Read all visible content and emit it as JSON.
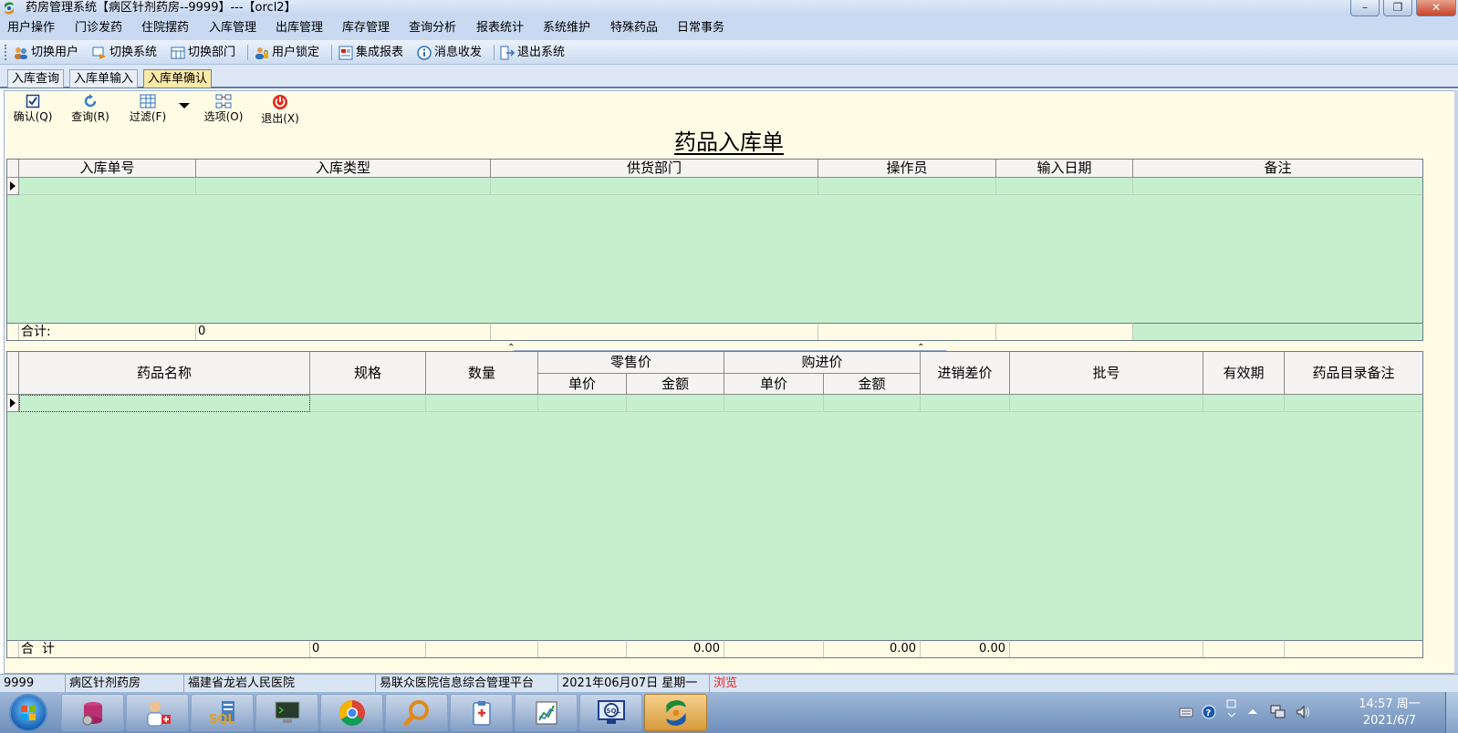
{
  "window": {
    "title": "药房管理系统【病区针剂药房--9999】---【orcl2】",
    "min_glyph": "–",
    "max_glyph": "❐",
    "close_glyph": "✕"
  },
  "menu": [
    "用户操作",
    "门诊发药",
    "住院摆药",
    "入库管理",
    "出库管理",
    "库存管理",
    "查询分析",
    "报表统计",
    "系统维护",
    "特殊药品",
    "日常事务"
  ],
  "toolbar": [
    {
      "label": "切换用户",
      "icon": "users-icon"
    },
    {
      "label": "切换系统",
      "icon": "switch-system-icon"
    },
    {
      "label": "切换部门",
      "icon": "department-icon"
    },
    {
      "label": "用户锁定",
      "icon": "user-lock-icon"
    },
    {
      "label": "集成报表",
      "icon": "report-icon"
    },
    {
      "label": "消息收发",
      "icon": "info-icon"
    },
    {
      "label": "退出系统",
      "icon": "exit-icon"
    }
  ],
  "tabs": [
    "入库查询",
    "入库单输入",
    "入库单确认"
  ],
  "actions": {
    "confirm": "确认(Q)",
    "query": "查询(R)",
    "filter": "过滤(F)",
    "options": "选项(O)",
    "exit": "退出(X)"
  },
  "doc_title": "药品入库单",
  "top_grid": {
    "columns": [
      "入库单号",
      "入库类型",
      "供货部门",
      "操作员",
      "输入日期",
      "备注"
    ],
    "footer_label": "合计:",
    "footer_value": "0"
  },
  "bottom_grid": {
    "columns": {
      "name": "药品名称",
      "spec": "规格",
      "qty": "数量",
      "retail": "零售价",
      "retail_unit": "单价",
      "retail_amount": "金额",
      "purchase": "购进价",
      "purchase_unit": "单价",
      "purchase_amount": "金额",
      "diff": "进销差价",
      "batch": "批号",
      "expiry": "有效期",
      "note": "药品目录备注"
    },
    "footer": {
      "label": "合  计",
      "qty": "0",
      "retail_amount": "0.00",
      "purchase_amount": "0.00",
      "diff": "0.00"
    }
  },
  "status": {
    "code": "9999",
    "dept": "病区针剂药房",
    "hospital": "福建省龙岩人民医院",
    "platform": "易联众医院信息综合管理平台",
    "date": "2021年06月07日  星期一",
    "mode": "浏览"
  },
  "taskbar": {
    "apps": [
      "database-icon",
      "doctor-icon",
      "sql-server-icon",
      "terminal-icon",
      "chrome-icon",
      "search-icon",
      "clipboard-icon",
      "chart-icon",
      "sql-query-icon",
      "app-logo-icon"
    ],
    "active_index": 9,
    "time": "14:57 周一",
    "date": "2021/6/7"
  },
  "colors": {
    "grid_green": "#c6efce",
    "panel_cream": "#fffce6",
    "active_tab": "#fbe9a8",
    "mode_red": "#e02020"
  }
}
